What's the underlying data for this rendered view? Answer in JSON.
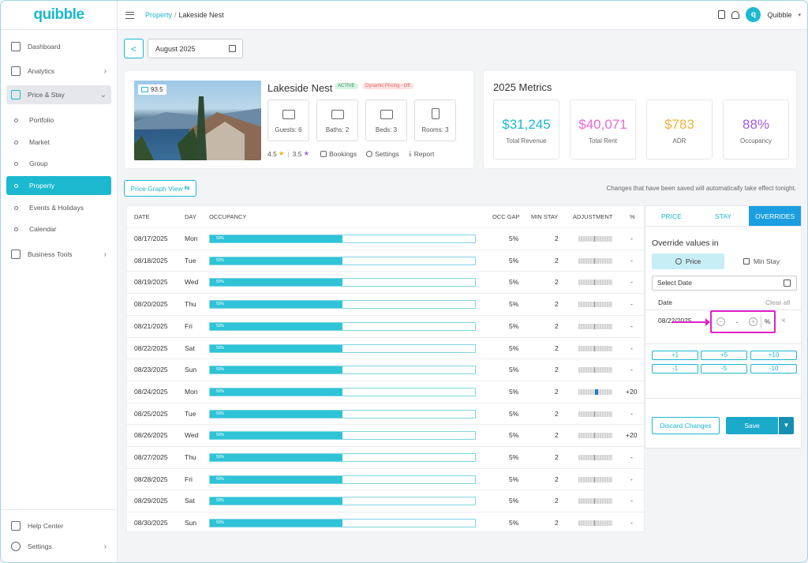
{
  "app": {
    "brand": "quibble",
    "accent": "#1bb8d0"
  },
  "sidebar": {
    "items": [
      {
        "label": "Dashboard",
        "icon": "grid-icon"
      },
      {
        "label": "Analytics",
        "icon": "chart-icon"
      },
      {
        "label": "Price & Stay",
        "icon": "house-dollar-icon"
      },
      {
        "label": "Portfolio"
      },
      {
        "label": "Market"
      },
      {
        "label": "Group"
      },
      {
        "label": "Property"
      },
      {
        "label": "Events & Holidays"
      },
      {
        "label": "Calendar"
      },
      {
        "label": "Business Tools",
        "icon": "briefcase-icon"
      }
    ],
    "bottom": [
      {
        "label": "Help Center",
        "icon": "help-icon"
      },
      {
        "label": "Settings",
        "icon": "gear-icon"
      }
    ]
  },
  "topbar": {
    "breadcrumb_parent": "Property",
    "breadcrumb_sep": "/",
    "breadcrumb_current": "Lakeside Nest",
    "user_initial": "q",
    "user_name": "Quibble"
  },
  "controls": {
    "back": "<",
    "month": "August 2025"
  },
  "property": {
    "photo_score": "93.5",
    "name": "Lakeside Nest",
    "status_badge": "ACTIVE",
    "pricing_badge": "Dynamic Pricing - Off",
    "amenities": [
      {
        "label": "Guests: 6",
        "icon": "guests-icon"
      },
      {
        "label": "Baths: 2",
        "icon": "bathtub-icon"
      },
      {
        "label": "Beds: 3",
        "icon": "bed-icon"
      },
      {
        "label": "Rooms: 3",
        "icon": "door-icon"
      }
    ],
    "rating_1": "4.5",
    "rating_2": "3.5",
    "links": {
      "bookings": "Bookings",
      "settings": "Settings",
      "report": "Report"
    }
  },
  "metrics": {
    "title": "2025 Metrics",
    "items": [
      {
        "value": "$31,245",
        "label": "Total Revenue",
        "color": "#1bb8d0"
      },
      {
        "value": "$40,071",
        "label": "Total Rent",
        "color": "#e86ad8"
      },
      {
        "value": "$783",
        "label": "ADR",
        "color": "#f0b43c"
      },
      {
        "value": "88%",
        "label": "Occupancy",
        "color": "#a35ce0"
      }
    ]
  },
  "graph_view_label": "Price Graph View",
  "graph_view_suffix": "⇆",
  "save_note": "Changes that have been saved will automatically take effect tonight.",
  "table": {
    "headers": {
      "date": "DATE",
      "day": "DAY",
      "occupancy": "OCCUPANCY",
      "occ_gap": "OCC GAP",
      "min_stay": "MIN STAY",
      "adjustment": "ADJUSTMENT",
      "pct": "%"
    },
    "rows": [
      {
        "date": "08/17/2025",
        "day": "Mon",
        "occ": "50%",
        "occ_fill": 0.5,
        "gap": "5%",
        "min": "2",
        "pct": "-",
        "adj": "none"
      },
      {
        "date": "08/18/2025",
        "day": "Tue",
        "occ": "50%",
        "occ_fill": 0.5,
        "gap": "5%",
        "min": "2",
        "pct": "-",
        "adj": "none"
      },
      {
        "date": "08/19/2025",
        "day": "Wed",
        "occ": "50%",
        "occ_fill": 0.5,
        "gap": "5%",
        "min": "2",
        "pct": "-",
        "adj": "none"
      },
      {
        "date": "08/20/2025",
        "day": "Thu",
        "occ": "50%",
        "occ_fill": 0.5,
        "gap": "5%",
        "min": "2",
        "pct": "-",
        "adj": "none"
      },
      {
        "date": "08/21/2025",
        "day": "Fri",
        "occ": "50%",
        "occ_fill": 0.5,
        "gap": "5%",
        "min": "2",
        "pct": "-",
        "adj": "none"
      },
      {
        "date": "08/22/2025",
        "day": "Sat",
        "occ": "50%",
        "occ_fill": 0.5,
        "gap": "5%",
        "min": "2",
        "pct": "-",
        "adj": "none"
      },
      {
        "date": "08/23/2025",
        "day": "Sun",
        "occ": "50%",
        "occ_fill": 0.5,
        "gap": "5%",
        "min": "2",
        "pct": "-",
        "adj": "none"
      },
      {
        "date": "08/24/2025",
        "day": "Mon",
        "occ": "50%",
        "occ_fill": 0.5,
        "gap": "5%",
        "min": "2",
        "pct": "+20",
        "adj": "up"
      },
      {
        "date": "08/25/2025",
        "day": "Tue",
        "occ": "50%",
        "occ_fill": 0.5,
        "gap": "5%",
        "min": "2",
        "pct": "-",
        "adj": "none"
      },
      {
        "date": "08/26/2025",
        "day": "Wed",
        "occ": "50%",
        "occ_fill": 0.5,
        "gap": "5%",
        "min": "2",
        "pct": "+20",
        "adj": "none"
      },
      {
        "date": "08/27/2025",
        "day": "Thu",
        "occ": "50%",
        "occ_fill": 0.5,
        "gap": "5%",
        "min": "2",
        "pct": "-",
        "adj": "none"
      },
      {
        "date": "08/28/2025",
        "day": "Fri",
        "occ": "50%",
        "occ_fill": 0.5,
        "gap": "5%",
        "min": "2",
        "pct": "-",
        "adj": "none"
      },
      {
        "date": "08/29/2025",
        "day": "Sat",
        "occ": "50%",
        "occ_fill": 0.5,
        "gap": "5%",
        "min": "2",
        "pct": "-",
        "adj": "none"
      },
      {
        "date": "08/30/2025",
        "day": "Sun",
        "occ": "50%",
        "occ_fill": 0.5,
        "gap": "5%",
        "min": "2",
        "pct": "-",
        "adj": "none"
      }
    ]
  },
  "overrides": {
    "tabs": [
      "PRICE",
      "STAY",
      "OVERRIDES"
    ],
    "active_tab": "OVERRIDES",
    "title": "Override values in",
    "toggle_price": "Price",
    "toggle_stay": "Min Stay",
    "select_date_placeholder": "Select Date",
    "date_header": "Date",
    "clear_all": "Clear all",
    "row_date": "08/22/2025",
    "stepper_minus": "−",
    "stepper_value": "-",
    "stepper_plus": "+",
    "stepper_unit": "%",
    "remove": "×",
    "quick": [
      "+1",
      "+5",
      "+10",
      "-1",
      "-5",
      "-10"
    ],
    "discard": "Discard Changes",
    "save": "Save",
    "save_caret": "▼"
  }
}
